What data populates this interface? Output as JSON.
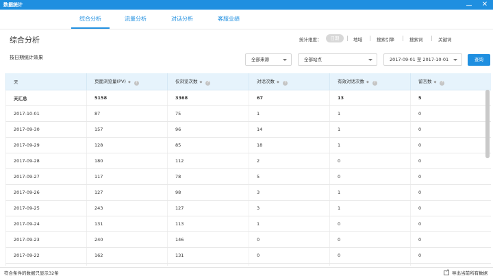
{
  "window": {
    "title": "数据统计",
    "close_glyph": "✕"
  },
  "tabs": [
    {
      "label": "综合分析",
      "active": true
    },
    {
      "label": "流量分析",
      "active": false
    },
    {
      "label": "对话分析",
      "active": false
    },
    {
      "label": "客服业绩",
      "active": false
    }
  ],
  "page_title": "综合分析",
  "dimension": {
    "label": "统计维度：",
    "options": [
      "日期",
      "地域",
      "搜索引擎",
      "搜索词",
      "关键词"
    ]
  },
  "subtitle": "按日期统计效果",
  "filters": {
    "source": "全部来源",
    "site": "全部站点",
    "date_range": "2017-09-01 至 2017-10-01",
    "query_label": "查询"
  },
  "table": {
    "columns": [
      {
        "label": "天",
        "sortable": false,
        "help": false
      },
      {
        "label": "页面浏览量(PV)",
        "sortable": true,
        "help": true
      },
      {
        "label": "仅浏览次数",
        "sortable": true,
        "help": true
      },
      {
        "label": "对话次数",
        "sortable": true,
        "help": true
      },
      {
        "label": "有效对话次数",
        "sortable": true,
        "help": true
      },
      {
        "label": "留言数",
        "sortable": true,
        "help": true
      }
    ],
    "sort_glyph": "◆",
    "help_glyph": "?",
    "total": [
      "天汇总",
      "5158",
      "3368",
      "67",
      "13",
      "5"
    ],
    "rows": [
      [
        "2017-10-01",
        "87",
        "75",
        "1",
        "1",
        "0"
      ],
      [
        "2017-09-30",
        "157",
        "96",
        "14",
        "1",
        "0"
      ],
      [
        "2017-09-29",
        "128",
        "85",
        "18",
        "1",
        "0"
      ],
      [
        "2017-09-28",
        "180",
        "112",
        "2",
        "0",
        "0"
      ],
      [
        "2017-09-27",
        "117",
        "78",
        "5",
        "0",
        "0"
      ],
      [
        "2017-09-26",
        "127",
        "98",
        "3",
        "1",
        "0"
      ],
      [
        "2017-09-25",
        "243",
        "127",
        "3",
        "1",
        "0"
      ],
      [
        "2017-09-24",
        "131",
        "113",
        "1",
        "0",
        "0"
      ],
      [
        "2017-09-23",
        "240",
        "146",
        "0",
        "0",
        "0"
      ],
      [
        "2017-09-22",
        "162",
        "131",
        "0",
        "0",
        "0"
      ],
      [
        "",
        "",
        "",
        "",
        "",
        ""
      ]
    ]
  },
  "footer": {
    "count_text": "符合条件的数据只显示32条",
    "export_label": "导出当前所有数据"
  },
  "colors": {
    "accent": "#1f8fe0",
    "header_bg": "#e6f3fc"
  },
  "icons": {
    "export": "export-icon",
    "help": "help-icon",
    "sort": "sort-icon",
    "caret": "chevron-down-icon"
  }
}
